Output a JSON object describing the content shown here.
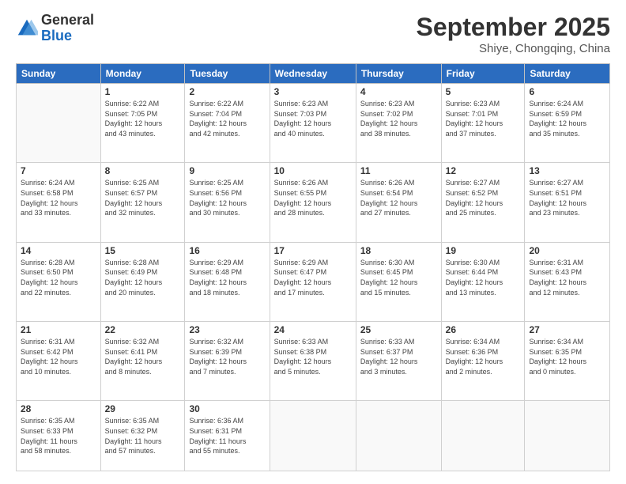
{
  "header": {
    "logo": {
      "general": "General",
      "blue": "Blue"
    },
    "title": "September 2025",
    "location": "Shiye, Chongqing, China"
  },
  "calendar": {
    "days_of_week": [
      "Sunday",
      "Monday",
      "Tuesday",
      "Wednesday",
      "Thursday",
      "Friday",
      "Saturday"
    ],
    "weeks": [
      [
        {
          "day": "",
          "info": ""
        },
        {
          "day": "1",
          "info": "Sunrise: 6:22 AM\nSunset: 7:05 PM\nDaylight: 12 hours\nand 43 minutes."
        },
        {
          "day": "2",
          "info": "Sunrise: 6:22 AM\nSunset: 7:04 PM\nDaylight: 12 hours\nand 42 minutes."
        },
        {
          "day": "3",
          "info": "Sunrise: 6:23 AM\nSunset: 7:03 PM\nDaylight: 12 hours\nand 40 minutes."
        },
        {
          "day": "4",
          "info": "Sunrise: 6:23 AM\nSunset: 7:02 PM\nDaylight: 12 hours\nand 38 minutes."
        },
        {
          "day": "5",
          "info": "Sunrise: 6:23 AM\nSunset: 7:01 PM\nDaylight: 12 hours\nand 37 minutes."
        },
        {
          "day": "6",
          "info": "Sunrise: 6:24 AM\nSunset: 6:59 PM\nDaylight: 12 hours\nand 35 minutes."
        }
      ],
      [
        {
          "day": "7",
          "info": "Sunrise: 6:24 AM\nSunset: 6:58 PM\nDaylight: 12 hours\nand 33 minutes."
        },
        {
          "day": "8",
          "info": "Sunrise: 6:25 AM\nSunset: 6:57 PM\nDaylight: 12 hours\nand 32 minutes."
        },
        {
          "day": "9",
          "info": "Sunrise: 6:25 AM\nSunset: 6:56 PM\nDaylight: 12 hours\nand 30 minutes."
        },
        {
          "day": "10",
          "info": "Sunrise: 6:26 AM\nSunset: 6:55 PM\nDaylight: 12 hours\nand 28 minutes."
        },
        {
          "day": "11",
          "info": "Sunrise: 6:26 AM\nSunset: 6:54 PM\nDaylight: 12 hours\nand 27 minutes."
        },
        {
          "day": "12",
          "info": "Sunrise: 6:27 AM\nSunset: 6:52 PM\nDaylight: 12 hours\nand 25 minutes."
        },
        {
          "day": "13",
          "info": "Sunrise: 6:27 AM\nSunset: 6:51 PM\nDaylight: 12 hours\nand 23 minutes."
        }
      ],
      [
        {
          "day": "14",
          "info": "Sunrise: 6:28 AM\nSunset: 6:50 PM\nDaylight: 12 hours\nand 22 minutes."
        },
        {
          "day": "15",
          "info": "Sunrise: 6:28 AM\nSunset: 6:49 PM\nDaylight: 12 hours\nand 20 minutes."
        },
        {
          "day": "16",
          "info": "Sunrise: 6:29 AM\nSunset: 6:48 PM\nDaylight: 12 hours\nand 18 minutes."
        },
        {
          "day": "17",
          "info": "Sunrise: 6:29 AM\nSunset: 6:47 PM\nDaylight: 12 hours\nand 17 minutes."
        },
        {
          "day": "18",
          "info": "Sunrise: 6:30 AM\nSunset: 6:45 PM\nDaylight: 12 hours\nand 15 minutes."
        },
        {
          "day": "19",
          "info": "Sunrise: 6:30 AM\nSunset: 6:44 PM\nDaylight: 12 hours\nand 13 minutes."
        },
        {
          "day": "20",
          "info": "Sunrise: 6:31 AM\nSunset: 6:43 PM\nDaylight: 12 hours\nand 12 minutes."
        }
      ],
      [
        {
          "day": "21",
          "info": "Sunrise: 6:31 AM\nSunset: 6:42 PM\nDaylight: 12 hours\nand 10 minutes."
        },
        {
          "day": "22",
          "info": "Sunrise: 6:32 AM\nSunset: 6:41 PM\nDaylight: 12 hours\nand 8 minutes."
        },
        {
          "day": "23",
          "info": "Sunrise: 6:32 AM\nSunset: 6:39 PM\nDaylight: 12 hours\nand 7 minutes."
        },
        {
          "day": "24",
          "info": "Sunrise: 6:33 AM\nSunset: 6:38 PM\nDaylight: 12 hours\nand 5 minutes."
        },
        {
          "day": "25",
          "info": "Sunrise: 6:33 AM\nSunset: 6:37 PM\nDaylight: 12 hours\nand 3 minutes."
        },
        {
          "day": "26",
          "info": "Sunrise: 6:34 AM\nSunset: 6:36 PM\nDaylight: 12 hours\nand 2 minutes."
        },
        {
          "day": "27",
          "info": "Sunrise: 6:34 AM\nSunset: 6:35 PM\nDaylight: 12 hours\nand 0 minutes."
        }
      ],
      [
        {
          "day": "28",
          "info": "Sunrise: 6:35 AM\nSunset: 6:33 PM\nDaylight: 11 hours\nand 58 minutes."
        },
        {
          "day": "29",
          "info": "Sunrise: 6:35 AM\nSunset: 6:32 PM\nDaylight: 11 hours\nand 57 minutes."
        },
        {
          "day": "30",
          "info": "Sunrise: 6:36 AM\nSunset: 6:31 PM\nDaylight: 11 hours\nand 55 minutes."
        },
        {
          "day": "",
          "info": ""
        },
        {
          "day": "",
          "info": ""
        },
        {
          "day": "",
          "info": ""
        },
        {
          "day": "",
          "info": ""
        }
      ]
    ]
  }
}
